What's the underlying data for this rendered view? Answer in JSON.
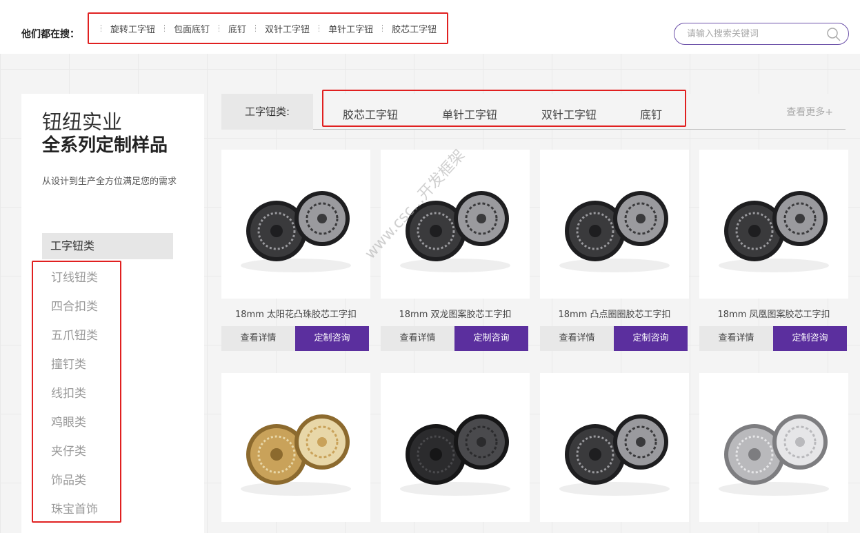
{
  "header": {
    "hot_label": "他们都在搜：",
    "hot_searches": [
      "旋转工字钮",
      "包面底钉",
      "底钉",
      "双针工字钮",
      "单针工字钮",
      "胶芯工字钮"
    ],
    "search_placeholder": "请输入搜索关键词",
    "search_icon": "search-icon"
  },
  "sidebar": {
    "title_line1": "钮纽实业",
    "title_line2": "全系列定制样品",
    "subtitle": "从设计到生产全方位满足您的需求",
    "active_category": "工字钮类",
    "categories": [
      "订线钮类",
      "四合扣类",
      "五爪钮类",
      "撞钉类",
      "线扣类",
      "鸡眼类",
      "夹仔类",
      "饰品类",
      "珠宝首饰"
    ]
  },
  "tabs": {
    "label": "工字钮类:",
    "items": [
      "胶芯工字钮",
      "单针工字钮",
      "双针工字钮",
      "底钉"
    ],
    "more": "查看更多+"
  },
  "products": [
    {
      "name": "18mm 太阳花凸珠胶芯工字扣",
      "detail": "查看详情",
      "consult": "定制咨询",
      "style": "dark"
    },
    {
      "name": "18mm 双龙图案胶芯工字扣",
      "detail": "查看详情",
      "consult": "定制咨询",
      "style": "dark"
    },
    {
      "name": "18mm 凸点圈圈胶芯工字扣",
      "detail": "查看详情",
      "consult": "定制咨询",
      "style": "dark"
    },
    {
      "name": "18mm 凤凰图案胶芯工字扣",
      "detail": "查看详情",
      "consult": "定制咨询",
      "style": "dark"
    },
    {
      "name": "",
      "style": "gold"
    },
    {
      "name": "",
      "style": "black"
    },
    {
      "name": "",
      "style": "dark"
    },
    {
      "name": "",
      "style": "silver"
    }
  ],
  "watermark": "www.csc...开发框架"
}
